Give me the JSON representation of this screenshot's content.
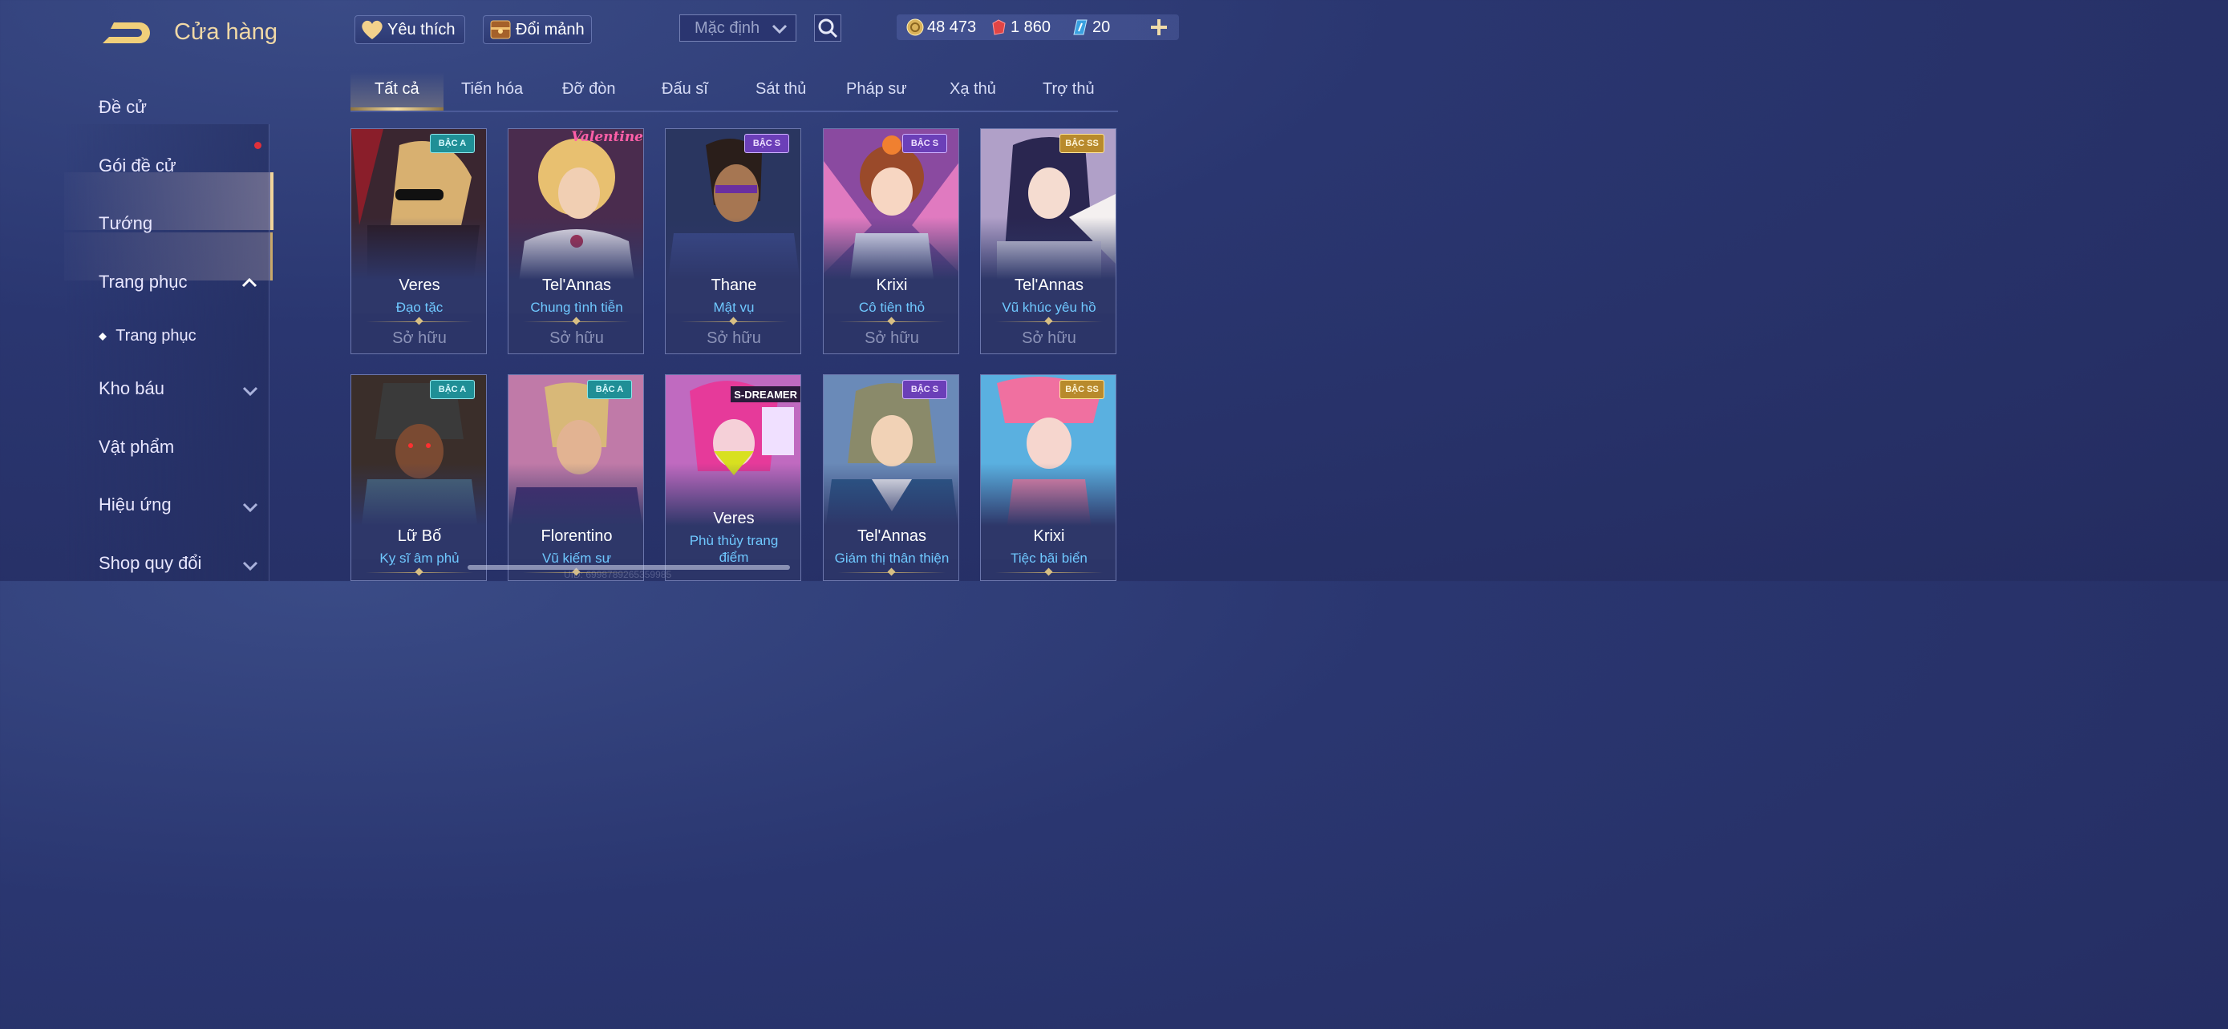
{
  "header": {
    "title": "Cửa hàng",
    "favorite_label": "Yêu thích",
    "exchange_label": "Đổi mảnh",
    "sort_value": "Mặc định"
  },
  "currency": {
    "gold": "48 473",
    "ruby": "1 860",
    "voucher": "20"
  },
  "sidebar": {
    "items": [
      {
        "label": "Đề cử"
      },
      {
        "label": "Gói đề cử"
      },
      {
        "label": "Tướng"
      },
      {
        "label": "Trang phục"
      },
      {
        "label": "Trang phục"
      },
      {
        "label": "Kho báu"
      },
      {
        "label": "Vật phẩm"
      },
      {
        "label": "Hiệu ứng"
      },
      {
        "label": "Shop quy đổi"
      }
    ]
  },
  "tabs": [
    {
      "label": "Tất cả",
      "active": true
    },
    {
      "label": "Tiến hóa"
    },
    {
      "label": "Đỡ đòn"
    },
    {
      "label": "Đấu sĩ"
    },
    {
      "label": "Sát thủ"
    },
    {
      "label": "Pháp sư"
    },
    {
      "label": "Xạ thủ"
    },
    {
      "label": "Trợ thủ"
    }
  ],
  "cards": [
    {
      "hero": "Veres",
      "skin": "Đạo tặc",
      "status": "Sở hữu",
      "badge": "BẬC A",
      "tier": "a"
    },
    {
      "hero": "Tel'Annas",
      "skin": "Chung tình tiễn",
      "status": "Sở hữu",
      "tag": "Valentine"
    },
    {
      "hero": "Thane",
      "skin": "Mật vụ",
      "status": "Sở hữu",
      "badge": "BẬC S",
      "tier": "s"
    },
    {
      "hero": "Krixi",
      "skin": "Cô tiên thỏ",
      "status": "Sở hữu",
      "badge": "BẬC S",
      "tier": "s"
    },
    {
      "hero": "Tel'Annas",
      "skin": "Vũ khúc yêu hồ",
      "status": "Sở hữu",
      "badge": "BẬC SS",
      "tier": "ss"
    },
    {
      "hero": "Lữ Bố",
      "skin": "Kỵ sĩ âm phủ",
      "badge": "BẬC A",
      "tier": "a"
    },
    {
      "hero": "Florentino",
      "skin": "Vũ kiếm sư",
      "badge": "BẬC A",
      "tier": "a"
    },
    {
      "hero": "Veres",
      "skin": "Phù thủy trang điểm",
      "tag2": "S-DREAMER"
    },
    {
      "hero": "Tel'Annas",
      "skin": "Giám thị thân thiện",
      "badge": "BẬC S",
      "tier": "s"
    },
    {
      "hero": "Krixi",
      "skin": "Tiệc bãi biển",
      "badge": "BẬC SS",
      "tier": "ss"
    }
  ],
  "footer": {
    "uid": "UID: 6998789265359985"
  },
  "colors": {
    "accent_gold": "#f1d9a6",
    "skin_name": "#6fc8ff",
    "background": "#2a3670",
    "badge_a": "#1f8f96",
    "badge_s": "#6b3fb8",
    "badge_ss": "#b88a2c"
  }
}
